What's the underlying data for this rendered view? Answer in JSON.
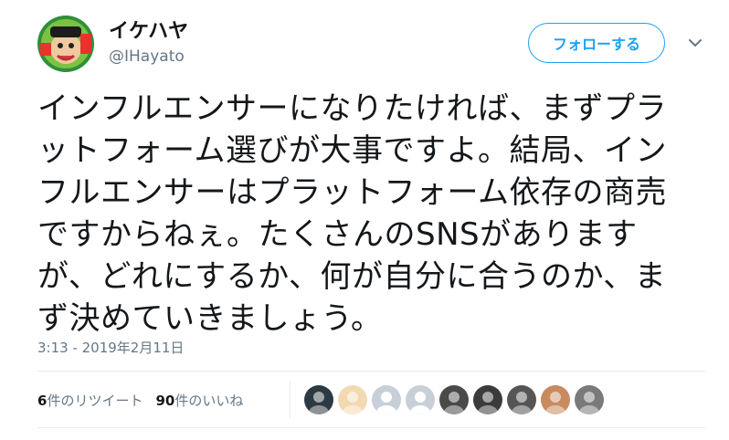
{
  "user": {
    "display_name": "イケハヤ",
    "handle": "@IHayato"
  },
  "follow_button": {
    "label": "フォローする"
  },
  "tweet": {
    "text": "インフルエンサーになりたければ、まずプラ\nットフォーム選びが大事ですよ。結局、イン\nフルエンサーはプラットフォーム依存の商売\nですからねぇ。たくさんのSNSがあります\nが、どれにするか、何が自分に合うのか、ま\nず決めていきましょう。",
    "timestamp": "3:13 - 2019年2月11日"
  },
  "stats": {
    "retweets_count": "6",
    "retweets_label": "件のリツイート",
    "likes_count": "90",
    "likes_label": "件のいいね"
  },
  "likers": [
    {
      "icon": "dark-photo-avatar",
      "color": "#2d3a44"
    },
    {
      "icon": "glasses-cartoon-avatar",
      "color": "#f3d9b1"
    },
    {
      "icon": "default-avatar",
      "color": "#c7d0d8"
    },
    {
      "icon": "default-avatar",
      "color": "#c7d0d8"
    },
    {
      "icon": "person-photo-avatar",
      "color": "#4a4a4a"
    },
    {
      "icon": "dark-photo-avatar",
      "color": "#3b3b3b"
    },
    {
      "icon": "bw-photo-avatar",
      "color": "#555555"
    },
    {
      "icon": "woman-photo-avatar",
      "color": "#c98a5e"
    },
    {
      "icon": "person-photo-avatar",
      "color": "#7a7a7a"
    }
  ],
  "colors": {
    "accent": "#1da1f2",
    "muted": "#657786",
    "divider": "#e6ecf0"
  }
}
